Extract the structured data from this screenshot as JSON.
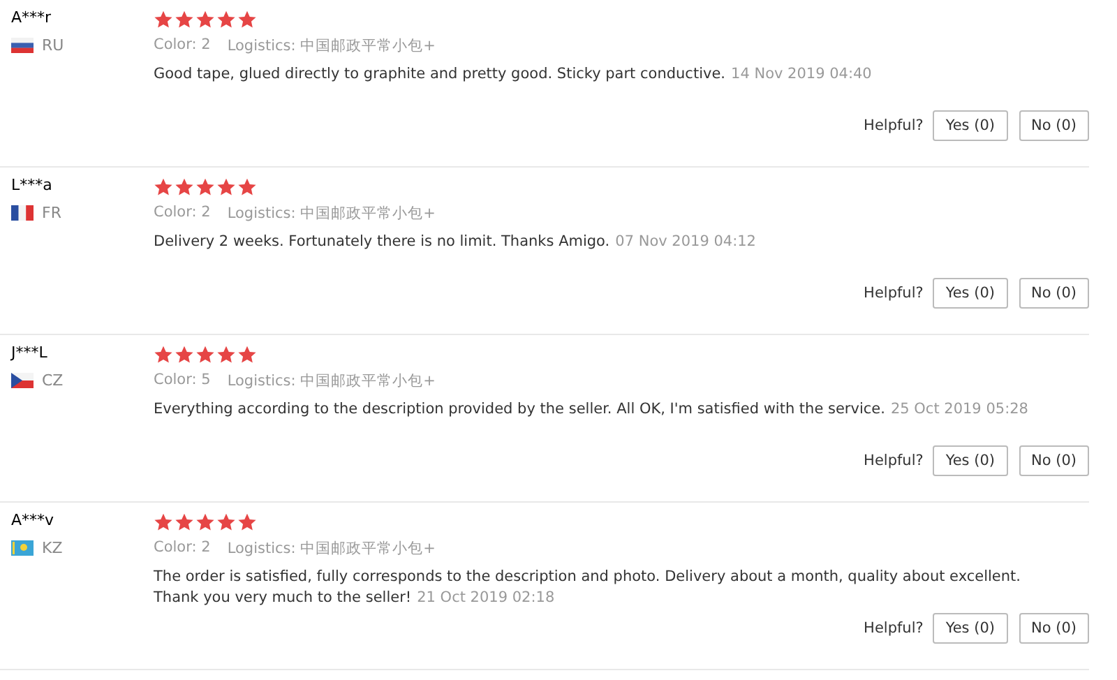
{
  "reviews": [
    {
      "name": "A***r",
      "kind": "ru",
      "country": "RU",
      "stars": 5,
      "color_label": "Color:",
      "color_value": "2",
      "logistics_label": "Logistics:",
      "logistics_value": "中国邮政平常小包+",
      "text": "Good tape, glued directly to graphite and pretty good. Sticky part conductive.",
      "date": "14 Nov 2019 04:40",
      "helpful": "Helpful?",
      "yes": "Yes (0)",
      "no": "No (0)"
    },
    {
      "name": "L***a",
      "kind": "fr",
      "country": "FR",
      "stars": 5,
      "color_label": "Color:",
      "color_value": "2",
      "logistics_label": "Logistics:",
      "logistics_value": "中国邮政平常小包+",
      "text": "Delivery 2 weeks. Fortunately there is no limit. Thanks Amigo.",
      "date": "07 Nov 2019 04:12",
      "helpful": "Helpful?",
      "yes": "Yes (0)",
      "no": "No (0)"
    },
    {
      "name": "J***L",
      "kind": "cz",
      "country": "CZ",
      "stars": 5,
      "color_label": "Color:",
      "color_value": "5",
      "logistics_label": "Logistics:",
      "logistics_value": "中国邮政平常小包+",
      "text": "Everything according to the description provided by the seller. All OK, I'm satisfied with the service.",
      "date": "25 Oct 2019 05:28",
      "helpful": "Helpful?",
      "yes": "Yes (0)",
      "no": "No (0)"
    },
    {
      "name": "A***v",
      "kind": "kz",
      "country": "KZ",
      "stars": 5,
      "color_label": "Color:",
      "color_value": "2",
      "logistics_label": "Logistics:",
      "logistics_value": "中国邮政平常小包+",
      "text": "The order is satisfied, fully corresponds to the description and photo. Delivery about a month, quality about excellent.\nThank you very much to the seller!",
      "date": "21 Oct 2019 02:18",
      "helpful": "Helpful?",
      "yes": "Yes (0)",
      "no": "No (0)"
    }
  ]
}
